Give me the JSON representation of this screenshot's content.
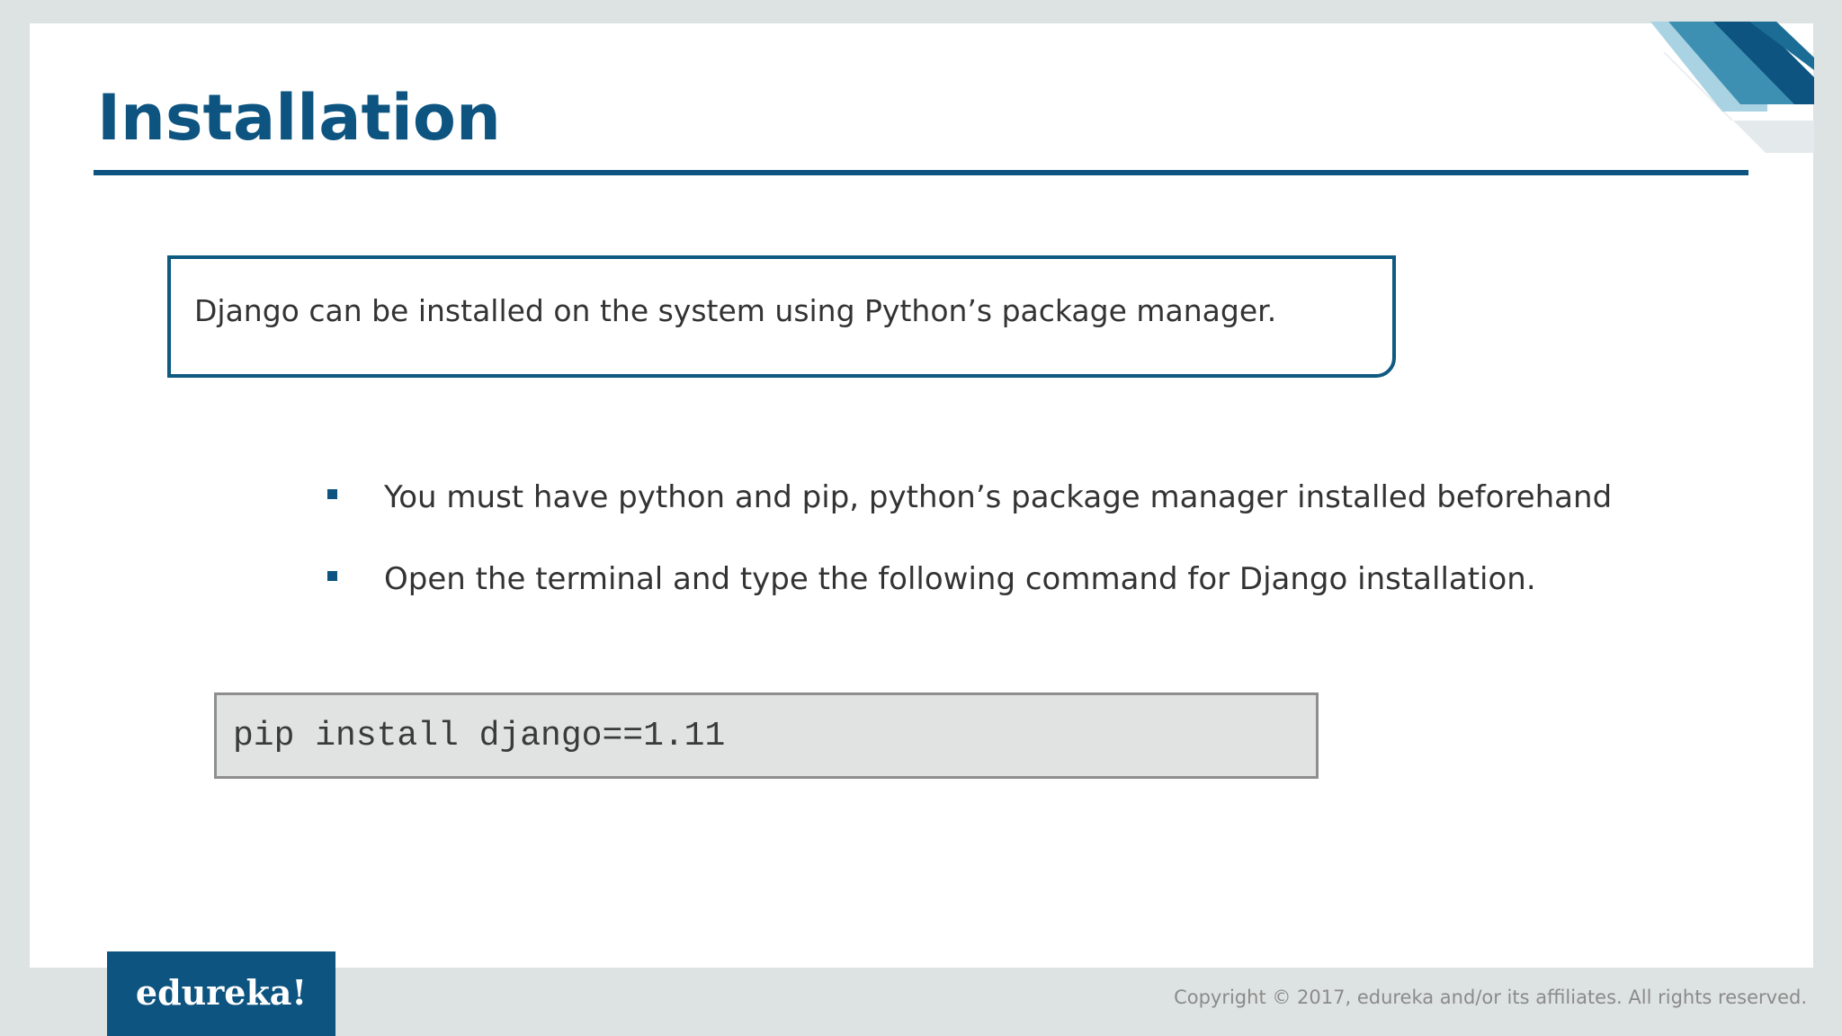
{
  "slide": {
    "title": "Installation",
    "intro": "Django can be installed on the system using Python’s package manager.",
    "bullets": [
      "You must have python and pip, python’s package manager installed beforehand",
      "Open the terminal and type the following command for Django installation."
    ],
    "code": "pip install django==1.11"
  },
  "footer": {
    "logo_text": "edureka!",
    "copyright": "Copyright © 2017, edureka and/or its affiliates. All rights reserved."
  },
  "colors": {
    "brand_blue": "#0d5480",
    "background_gray": "#dde3e2",
    "code_background": "#e1e3e3"
  },
  "icons": {
    "bullet": "square-bullet-icon",
    "corner": "corner-stripes-decoration"
  }
}
